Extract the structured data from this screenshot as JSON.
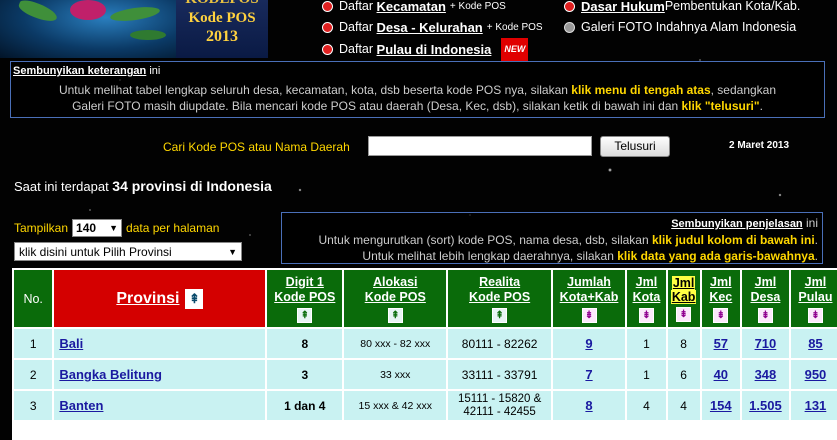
{
  "header": {
    "logo_top": "KODEPOS",
    "logo_line1": "Kode POS",
    "logo_line2": "2013"
  },
  "menu": {
    "col1": [
      {
        "prefix": "Daftar ",
        "link": "Kecamatan",
        "suffix": "+ Kode POS"
      },
      {
        "prefix": "Daftar ",
        "link": "Desa - Kelurahan",
        "suffix": "+ Kode POS"
      },
      {
        "prefix": "Daftar ",
        "link": "Pulau di Indonesia",
        "badge": "NEW"
      }
    ],
    "col2": [
      {
        "link": "Dasar Hukum",
        "text": " Pembentukan Kota/Kab."
      },
      {
        "text": "Galeri FOTO Indahnya Alam Indonesia"
      }
    ]
  },
  "info": {
    "toggle_link": "Sembunyikan keterangan",
    "toggle_suffix": " ini",
    "line1_a": "Untuk melihat tabel lengkap seluruh desa, kecamatan, kota, dsb beserta kode POS nya, silakan ",
    "line1_b": "klik menu di tengah atas",
    "line1_c": ", sedangkan",
    "line2_a": "Galeri FOTO masih diupdate. Bila mencari kode POS atau daerah (Desa, Kec, dsb), silakan ketik di bawah ini dan ",
    "line2_b": "klik \"telusuri\"",
    "line2_c": "."
  },
  "search": {
    "label": "Cari Kode POS atau Nama Daerah",
    "value": "",
    "button": "Telusuri",
    "date": "2 Maret 2013"
  },
  "count": {
    "prefix": "Saat ini terdapat ",
    "bold": "34 provinsi di Indonesia"
  },
  "controls": {
    "show_label": "Tampilkan",
    "per_page": "140",
    "per_page_suffix": "data per halaman",
    "province_select": "klik disini untuk Pilih Provinsi"
  },
  "explain": {
    "toggle_link": "Sembunyikan penjelasan",
    "toggle_suffix": " ini",
    "line1_a": "Untuk mengurutkan (sort) kode POS, nama desa, dsb, silakan ",
    "line1_b": "klik judul kolom di bawah ini",
    "line1_c": ".",
    "line2_a": "Untuk melihat lebih lengkap daerahnya, silakan ",
    "line2_b": "klik data yang ada garis-bawahnya",
    "line2_c": "."
  },
  "table": {
    "headers": {
      "no": "No.",
      "provinsi": "Provinsi",
      "digit1_a": "Digit 1",
      "digit1_b": "Kode POS",
      "alokasi_a": "Alokasi",
      "alokasi_b": "Kode POS",
      "realita_a": "Realita",
      "realita_b": "Kode POS",
      "jumlah_a": "Jumlah",
      "jumlah_b": "Kota+Kab",
      "jmlkota_a": "Jml",
      "jmlkota_b": "Kota",
      "jmlkab_a": "Jml",
      "jmlkab_b": "Kab",
      "jmlkec_a": "Jml",
      "jmlkec_b": "Kec",
      "jmldesa_a": "Jml",
      "jmldesa_b": "Desa",
      "jmlpulau_a": "Jml",
      "jmlpulau_b": "Pulau"
    },
    "rows": [
      {
        "no": "1",
        "provinsi": "Bali",
        "digit": "8",
        "alokasi": "80 xxx - 82 xxx",
        "realita": "80111 - 82262",
        "jumlah": "9",
        "kota": "1",
        "kab": "8",
        "kec": "57",
        "desa": "710",
        "pulau": "85"
      },
      {
        "no": "2",
        "provinsi": "Bangka Belitung",
        "digit": "3",
        "alokasi": "33 xxx",
        "realita": "33111 - 33791",
        "jumlah": "7",
        "kota": "1",
        "kab": "6",
        "kec": "40",
        "desa": "348",
        "pulau": "950"
      },
      {
        "no": "3",
        "provinsi": "Banten",
        "digit": "1 dan 4",
        "alokasi": "15 xxx & 42 xxx",
        "realita": "15111 - 15820 & 42111 - 42455",
        "jumlah": "8",
        "kota": "4",
        "kab": "4",
        "kec": "154",
        "desa": "1.505",
        "pulau": "131"
      }
    ]
  }
}
